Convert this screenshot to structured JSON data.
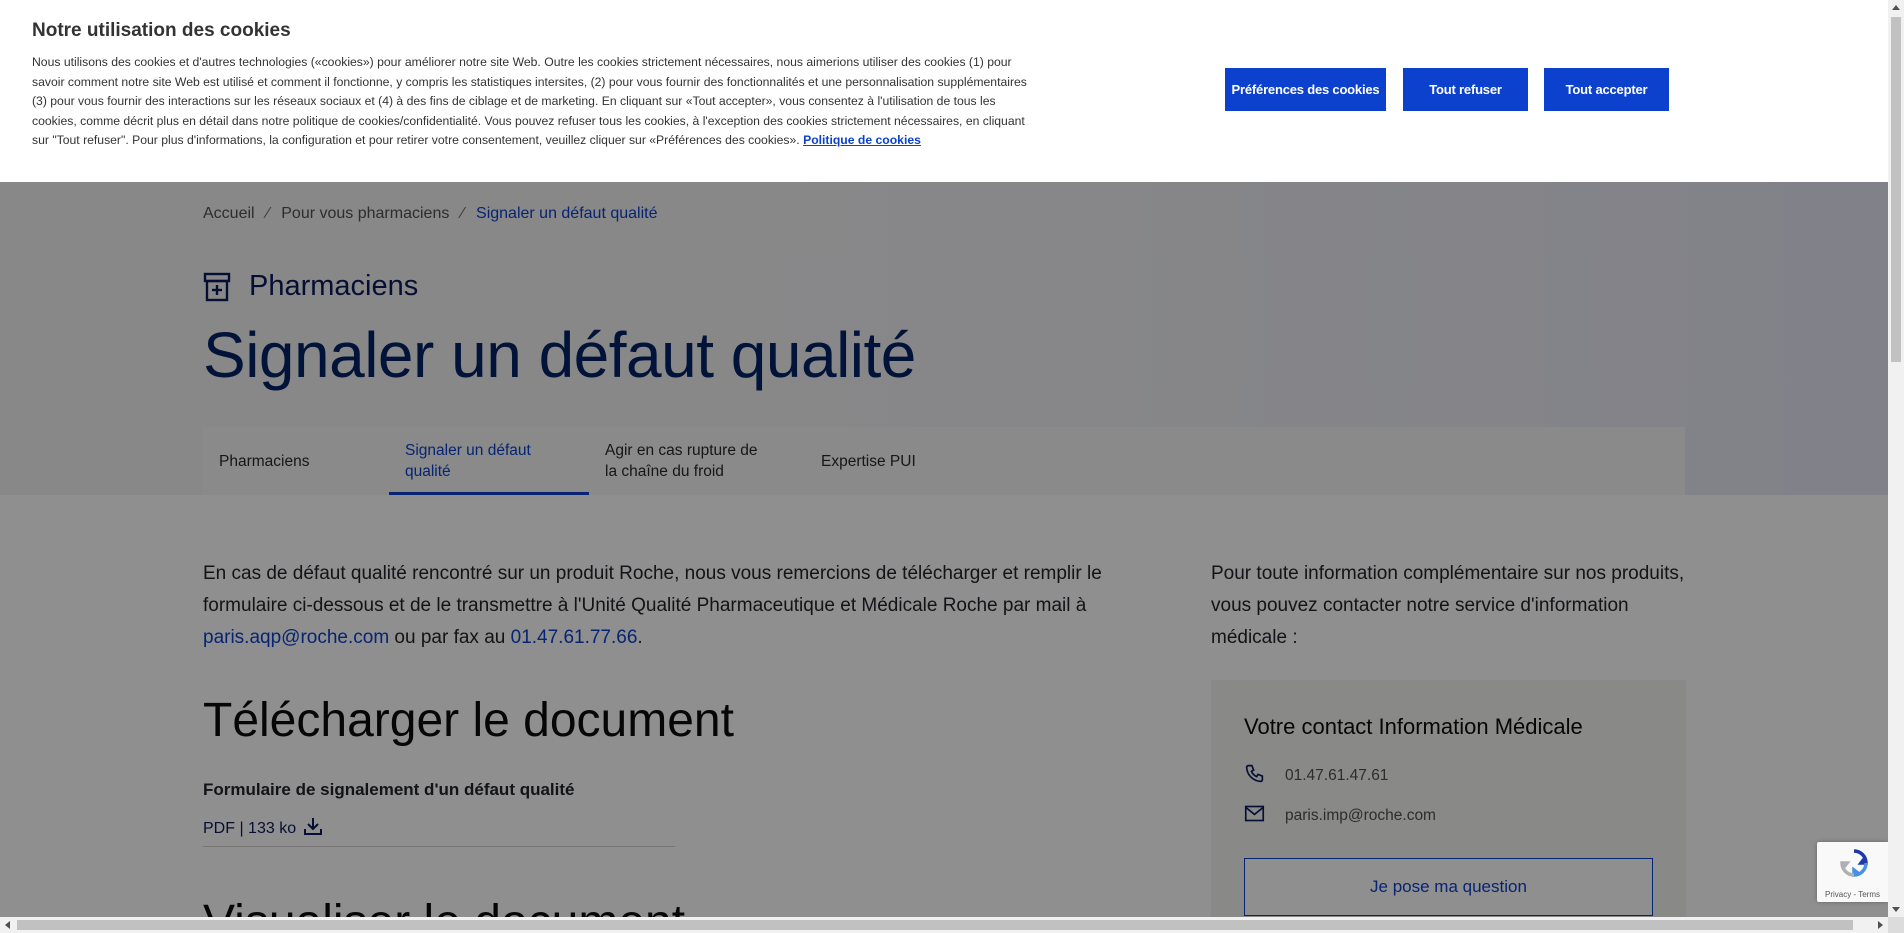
{
  "breadcrumb": {
    "home": "Accueil",
    "separator": "⁄",
    "parent": "Pour vous pharmaciens",
    "current": "Signaler un défaut qualité"
  },
  "section_label": {
    "icon": "pharmacy-icon",
    "text": "Pharmaciens"
  },
  "page_title": "Signaler un défaut qualité",
  "tabs": [
    {
      "line1": "Pharmaciens",
      "line2": ""
    },
    {
      "line1": "Signaler un défaut",
      "line2": "qualité"
    },
    {
      "line1": "Agir en cas rupture de",
      "line2": "la chaîne du froid"
    },
    {
      "line1": "Expertise PUI",
      "line2": ""
    }
  ],
  "intro": {
    "text_before": "En cas de défaut qualité rencontré sur un produit Roche, nous vous remercions de télécharger et remplir le formulaire ci-dessous et de le transmettre à l'Unité Qualité Pharmaceutique et Médicale Roche par mail à ",
    "email": "paris.aqp@roche.com",
    "text_middle": " ou par fax au ",
    "fax": "01.47.61.77.66",
    "text_after": "."
  },
  "download": {
    "heading": "Télécharger le document",
    "doc_name": "Formulaire de signalement d'un défaut qualité",
    "doc_meta": "PDF | 133 ko",
    "icon": "download-icon"
  },
  "next_heading": "Visualiser le document",
  "right": {
    "intro": "Pour toute information complémentaire sur nos produits, vous pouvez contacter notre service d'information médicale :",
    "card_title": "Votre contact Information Médicale",
    "phone": "01.47.61.47.61",
    "email": "paris.imp@roche.com",
    "ask_button": "Je pose ma question"
  },
  "cookie": {
    "title": "Notre utilisation des cookies",
    "body": "Nous utilisons des cookies et d'autres technologies («cookies») pour améliorer notre site Web. Outre les cookies strictement nécessaires, nous aimerions utiliser des cookies (1) pour savoir comment notre site Web est utilisé et comment il fonctionne, y compris les statistiques intersites, (2) pour vous fournir des fonctionnalités et une personnalisation supplémentaires (3) pour vous fournir des interactions sur les réseaux sociaux et (4) à des fins de ciblage et de marketing. En cliquant sur «Tout accepter», vous consentez à l'utilisation de tous les cookies, comme décrit plus en détail dans notre politique de cookies/confidentialité. Vous pouvez refuser tous les cookies, à l'exception des cookies strictement nécessaires, en cliquant sur \"Tout refuser\". Pour plus d'informations, la configuration et pour retirer votre consentement, veuillez cliquer sur «Préférences des cookies».",
    "policy_link": "Politique de cookies",
    "btn_preferences": "Préférences des cookies",
    "btn_refuse": "Tout refuser",
    "btn_accept": "Tout accepter"
  },
  "recaptcha": {
    "terms": "Privacy - Terms",
    "icon": "recaptcha-icon"
  },
  "colors": {
    "accent": "#0b41cd",
    "title": "#022366",
    "overlay": "rgba(0,0,0,0.44)"
  }
}
